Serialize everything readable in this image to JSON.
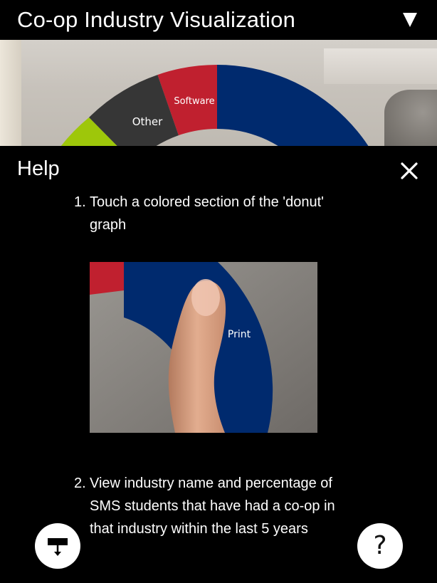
{
  "header": {
    "title": "Co-op Industry Visualization"
  },
  "donut": {
    "segments": [
      {
        "label": "Software",
        "color": "#c0202f"
      },
      {
        "label": "Other",
        "color": "#363636"
      },
      {
        "label": "",
        "color": "#9ec70a"
      },
      {
        "label": "",
        "color": "#002a6e"
      }
    ]
  },
  "help": {
    "title": "Help",
    "steps": [
      {
        "number": "1.",
        "text": "Touch a colored section of the 'donut' graph"
      },
      {
        "number": "2.",
        "text": "View industry name and percentage of SMS students that have had a co-op in that industry within the last 5 years"
      }
    ],
    "demo_label": "Print"
  },
  "buttons": {
    "help_symbol": "?"
  },
  "colors": {
    "print_blue": "#002a6e",
    "software_red": "#c0202f",
    "other_dark": "#363636",
    "accent_green": "#9ec70a"
  },
  "icons": {
    "menu": "triangle-down-icon",
    "close": "close-icon",
    "filter": "filter-download-icon"
  }
}
